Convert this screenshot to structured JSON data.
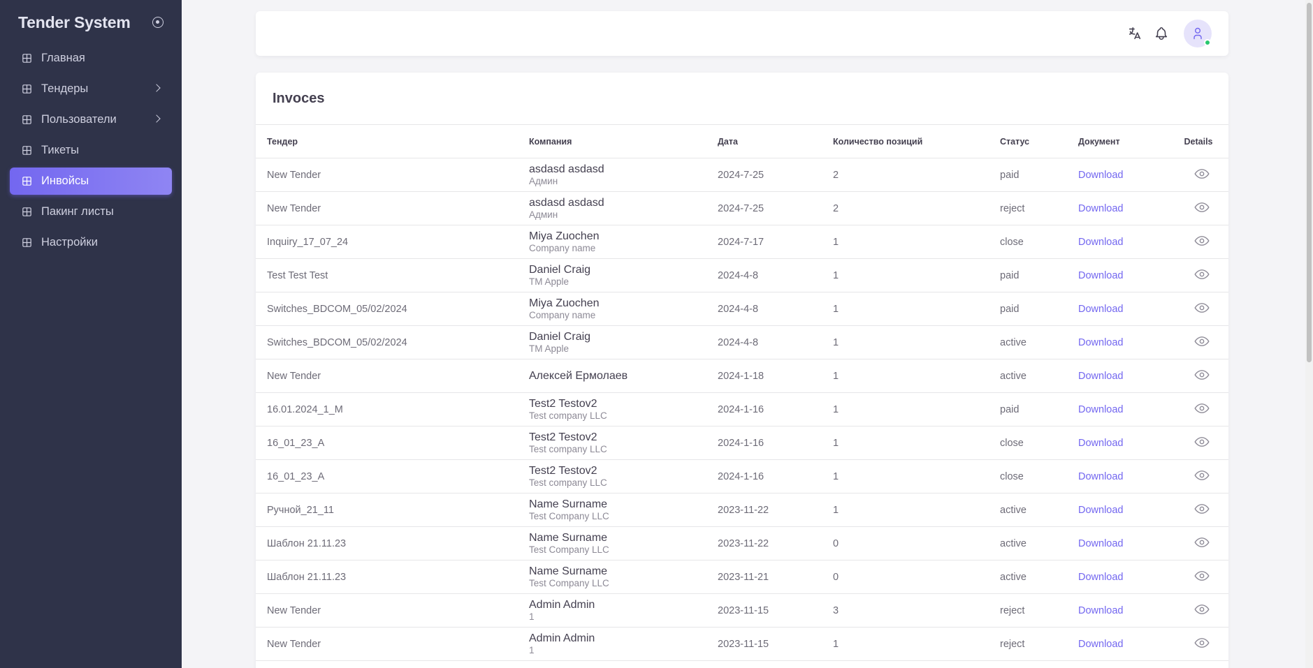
{
  "app": {
    "title": "Tender System"
  },
  "sidebar": {
    "items": [
      {
        "label": "Главная",
        "has_children": false,
        "active": false
      },
      {
        "label": "Тендеры",
        "has_children": true,
        "active": false
      },
      {
        "label": "Пользователи",
        "has_children": true,
        "active": false
      },
      {
        "label": "Тикеты",
        "has_children": false,
        "active": false
      },
      {
        "label": "Инвойсы",
        "has_children": false,
        "active": true
      },
      {
        "label": "Пакинг листы",
        "has_children": false,
        "active": false
      },
      {
        "label": "Настройки",
        "has_children": false,
        "active": false
      }
    ]
  },
  "topbar": {
    "icons": [
      "translate-icon",
      "bell-icon",
      "user-avatar"
    ],
    "status_color": "#28c76f"
  },
  "page": {
    "title": "Invoces",
    "columns": {
      "tender": "Тендер",
      "company": "Компания",
      "date": "Дата",
      "positions": "Количество позиций",
      "status": "Статус",
      "document": "Документ",
      "details": "Details"
    },
    "rows": [
      {
        "tender": "New Tender",
        "company": "asdasd asdasd",
        "company_sub": "Админ",
        "date": "2024-7-25",
        "positions": "2",
        "status": "paid",
        "document": "Download"
      },
      {
        "tender": "New Tender",
        "company": "asdasd asdasd",
        "company_sub": "Админ",
        "date": "2024-7-25",
        "positions": "2",
        "status": "reject",
        "document": "Download"
      },
      {
        "tender": "Inquiry_17_07_24",
        "company": "Miya Zuochen",
        "company_sub": "Company name",
        "date": "2024-7-17",
        "positions": "1",
        "status": "close",
        "document": "Download"
      },
      {
        "tender": "Test Test Test",
        "company": "Daniel Craig",
        "company_sub": "TM Apple",
        "date": "2024-4-8",
        "positions": "1",
        "status": "paid",
        "document": "Download"
      },
      {
        "tender": "Switches_BDCOM_05/02/2024",
        "company": "Miya Zuochen",
        "company_sub": "Company name",
        "date": "2024-4-8",
        "positions": "1",
        "status": "paid",
        "document": "Download"
      },
      {
        "tender": "Switches_BDCOM_05/02/2024",
        "company": "Daniel Craig",
        "company_sub": "TM Apple",
        "date": "2024-4-8",
        "positions": "1",
        "status": "active",
        "document": "Download"
      },
      {
        "tender": "New Tender",
        "company": "Алексей Ермолаев",
        "company_sub": "",
        "date": "2024-1-18",
        "positions": "1",
        "status": "active",
        "document": "Download"
      },
      {
        "tender": "16.01.2024_1_M",
        "company": "Test2 Testov2",
        "company_sub": "Test company LLC",
        "date": "2024-1-16",
        "positions": "1",
        "status": "paid",
        "document": "Download"
      },
      {
        "tender": "16_01_23_A",
        "company": "Test2 Testov2",
        "company_sub": "Test company LLC",
        "date": "2024-1-16",
        "positions": "1",
        "status": "close",
        "document": "Download"
      },
      {
        "tender": "16_01_23_A",
        "company": "Test2 Testov2",
        "company_sub": "Test company LLC",
        "date": "2024-1-16",
        "positions": "1",
        "status": "close",
        "document": "Download"
      },
      {
        "tender": "Ручной_21_11",
        "company": "Name Surname",
        "company_sub": "Test Company LLC",
        "date": "2023-11-22",
        "positions": "1",
        "status": "active",
        "document": "Download"
      },
      {
        "tender": "Шаблон 21.11.23",
        "company": "Name Surname",
        "company_sub": "Test Company LLC",
        "date": "2023-11-22",
        "positions": "0",
        "status": "active",
        "document": "Download"
      },
      {
        "tender": "Шаблон 21.11.23",
        "company": "Name Surname",
        "company_sub": "Test Company LLC",
        "date": "2023-11-21",
        "positions": "0",
        "status": "active",
        "document": "Download"
      },
      {
        "tender": "New Tender",
        "company": "Admin Admin",
        "company_sub": "1",
        "date": "2023-11-15",
        "positions": "3",
        "status": "reject",
        "document": "Download"
      },
      {
        "tender": "New Tender",
        "company": "Admin Admin",
        "company_sub": "1",
        "date": "2023-11-15",
        "positions": "1",
        "status": "reject",
        "document": "Download"
      }
    ]
  },
  "colors": {
    "accent": "#7367f0",
    "sidebar_bg": "#2f3349",
    "page_bg": "#f4f4f7"
  }
}
